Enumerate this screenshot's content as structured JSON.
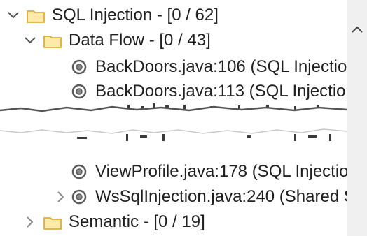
{
  "tree": {
    "items": [
      {
        "label": "SQL Injection - [0 / 62]",
        "expanded": true,
        "kind": "folder",
        "icon": "folder-icon"
      },
      {
        "label": "Data Flow - [0 / 43]",
        "expanded": true,
        "kind": "folder",
        "icon": "folder-icon"
      },
      {
        "label": "BackDoors.java:106 (SQL Injection",
        "kind": "issue",
        "icon": "issue-target-icon"
      },
      {
        "label": "BackDoors.java:113 (SQL Injection",
        "kind": "issue",
        "icon": "issue-target-icon"
      },
      {
        "label": "ViewProfile.java:178 (SQL Injectior",
        "kind": "issue",
        "icon": "issue-target-icon"
      },
      {
        "label": "WsSqlInjection.java:240 (Shared Si",
        "expanded": false,
        "kind": "issue",
        "icon": "issue-target-icon"
      },
      {
        "label": "Semantic - [0 / 19]",
        "expanded": false,
        "kind": "folder",
        "icon": "folder-icon"
      }
    ]
  },
  "colors": {
    "folder_stroke": "#d9a426",
    "folder_fill": "#fde9a8",
    "chevron": "#555555",
    "scrollbar_track": "#f0f0f0",
    "issue_icon": "#5a5a5a"
  }
}
